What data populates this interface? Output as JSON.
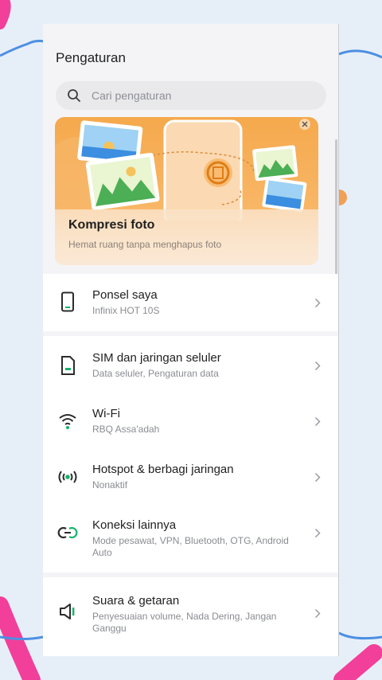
{
  "colors": {
    "accent_green": "#16b36a",
    "background": "#e6eff8",
    "decoration_pink": "#f23f9a",
    "decoration_blue": "#4d8fe3",
    "banner_orange": "#f5a94d"
  },
  "header": {
    "title": "Pengaturan"
  },
  "search": {
    "placeholder": "Cari pengaturan",
    "icon": "search-icon"
  },
  "banner": {
    "title": "Kompresi foto",
    "subtitle": "Hemat ruang tanpa menghapus foto"
  },
  "groups": [
    {
      "items": [
        {
          "title": "Ponsel saya",
          "subtitle": "Infinix HOT 10S",
          "icon": "phone-icon"
        }
      ]
    },
    {
      "items": [
        {
          "title": "SIM dan jaringan seluler",
          "subtitle": "Data seluler, Pengaturan data",
          "icon": "sim-card-icon"
        },
        {
          "title": "Wi-Fi",
          "subtitle": "RBQ Assa'adah",
          "icon": "wifi-icon"
        },
        {
          "title": "Hotspot & berbagi jaringan",
          "subtitle": "Nonaktif",
          "icon": "hotspot-icon"
        },
        {
          "title": "Koneksi lainnya",
          "subtitle": "Mode pesawat, VPN, Bluetooth, OTG, Android Auto",
          "icon": "link-icon"
        }
      ]
    },
    {
      "items": [
        {
          "title": "Suara & getaran",
          "subtitle": "Penyesuaian volume, Nada Dering, Jangan Ganggu",
          "icon": "speaker-icon"
        }
      ]
    }
  ]
}
